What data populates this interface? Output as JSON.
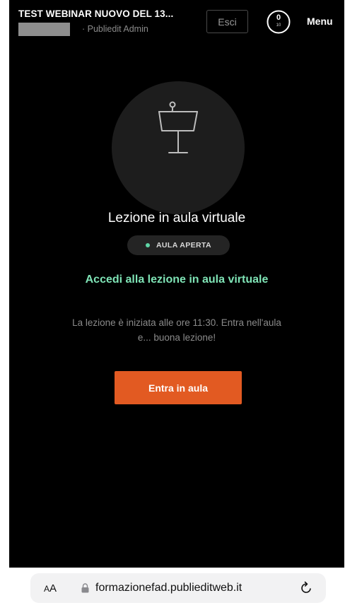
{
  "header": {
    "course_title": "TEST WEBINAR NUOVO DEL 13...",
    "author_role": "· Publiedit Admin",
    "exit_label": "Esci",
    "progress": {
      "current": "0",
      "total": "10"
    },
    "menu_label": "Menu"
  },
  "lesson": {
    "icon": "lectern-icon",
    "title": "Lezione in aula virtuale",
    "status": "AULA APERTA",
    "cta_heading": "Accedi alla lezione in aula virtuale",
    "description": "La lezione è iniziata alle ore 11:30. Entra nell'aula e... buona lezione!",
    "enter_label": "Entra in aula"
  },
  "browser": {
    "text_size_label_small": "A",
    "text_size_label_large": "A",
    "url": "formazionefad.publieditweb.it"
  },
  "colors": {
    "accent_orange": "#e25a22",
    "status_green": "#5fd6a6",
    "heading_green": "#7fe4b6"
  }
}
